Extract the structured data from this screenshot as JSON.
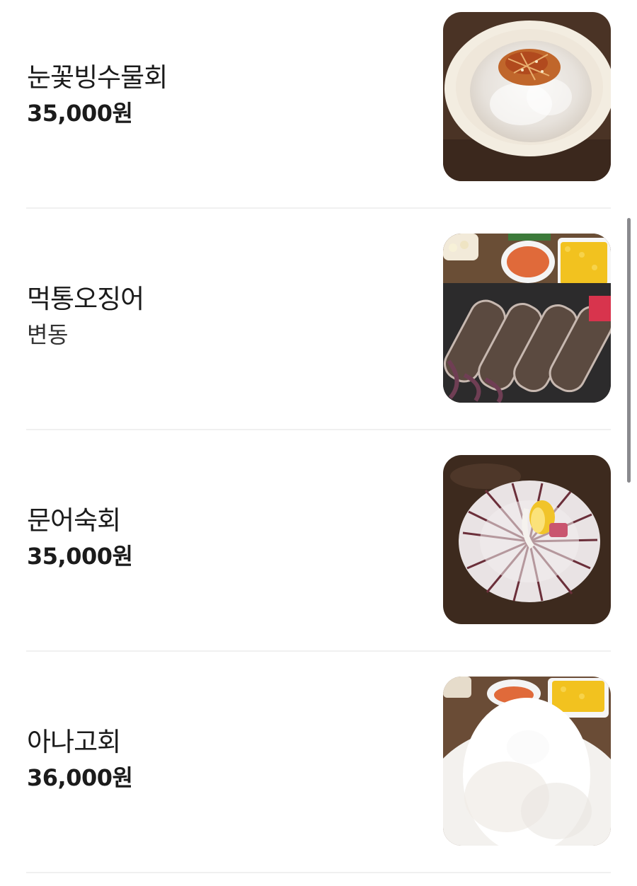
{
  "menu": {
    "items": [
      {
        "name": "눈꽃빙수물회",
        "price": "35,000원",
        "image_icon": "bingsu-mulhoe-photo"
      },
      {
        "name": "먹통오징어",
        "price": "변동",
        "image_icon": "squid-platter-photo"
      },
      {
        "name": "문어숙회",
        "price": "35,000원",
        "image_icon": "octopus-sukhoe-photo"
      },
      {
        "name": "아나고회",
        "price": "36,000원",
        "image_icon": "anago-hoe-photo"
      }
    ]
  },
  "colors": {
    "text": "#1b1b1b",
    "divider": "#f0f0f0",
    "scrollbar": "#8a8a8e"
  }
}
